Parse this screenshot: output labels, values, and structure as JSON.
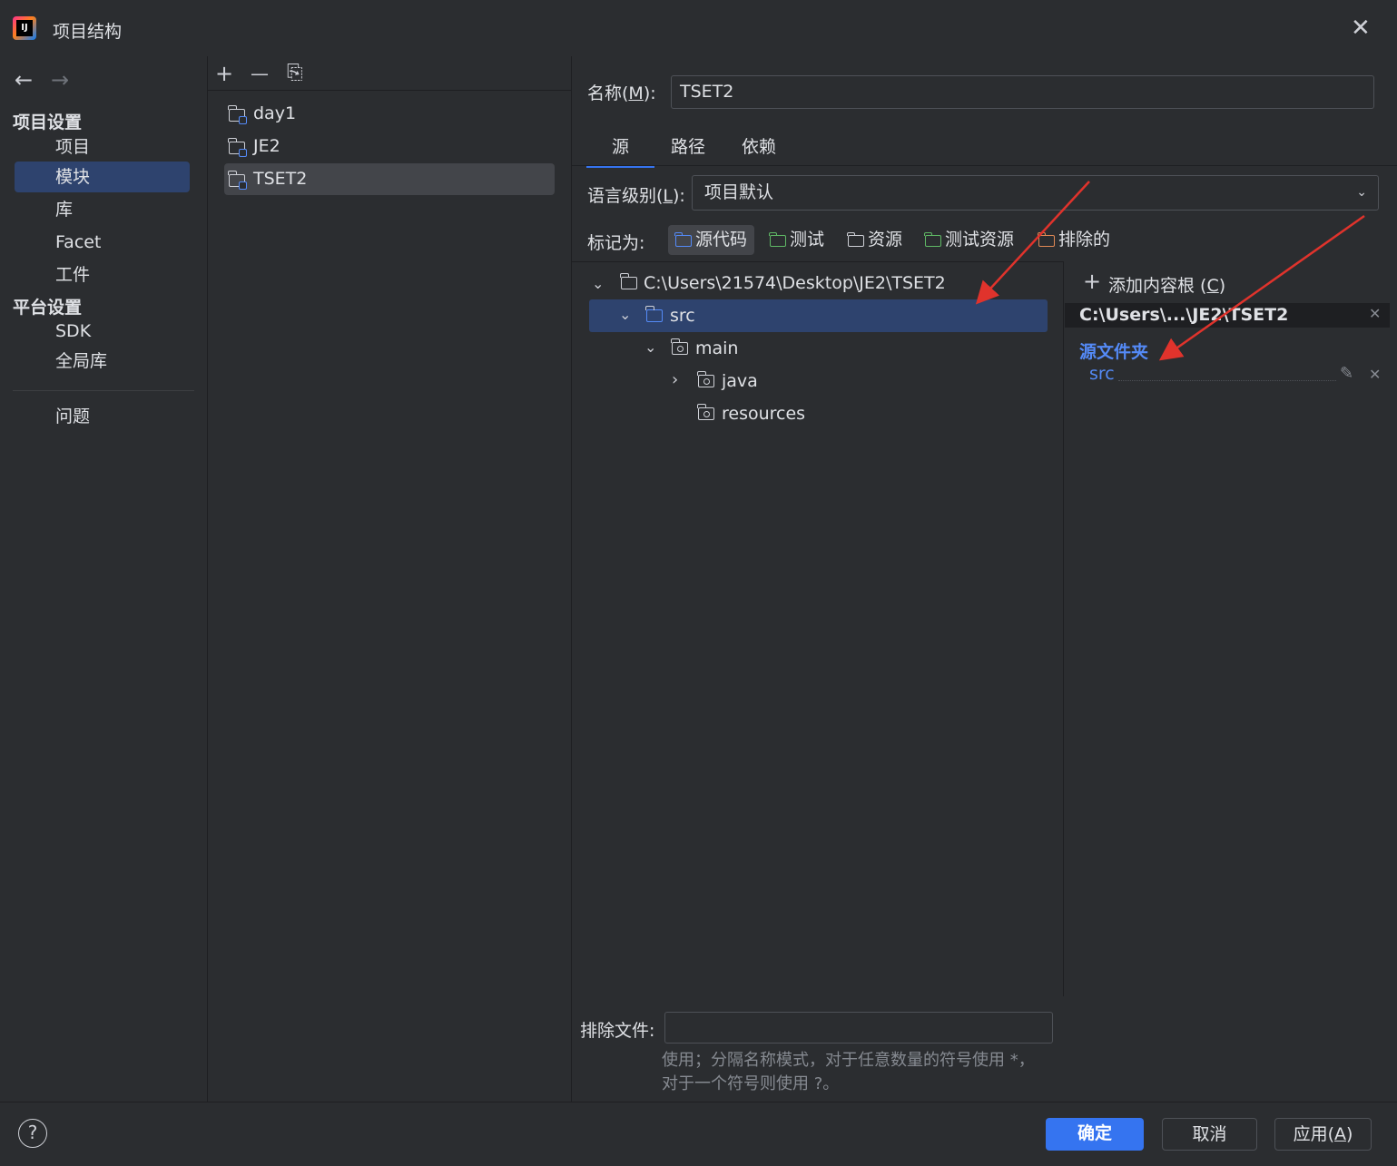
{
  "window": {
    "title": "项目结构",
    "close_glyph": "✕"
  },
  "nav": {
    "back": "←",
    "forward": "→"
  },
  "sidebar": {
    "project_settings_title": "项目设置",
    "project_items": [
      "项目",
      "模块",
      "库",
      "Facet",
      "工件"
    ],
    "platform_settings_title": "平台设置",
    "platform_items": [
      "SDK",
      "全局库"
    ],
    "problems": "问题",
    "selected": "模块"
  },
  "module_list": {
    "toolbar": {
      "add": "+",
      "remove": "—",
      "copy": "⎘"
    },
    "modules": [
      "day1",
      "JE2",
      "TSET2"
    ],
    "selected": "TSET2"
  },
  "detail": {
    "name_label": "名称(",
    "name_mnemonic": "M",
    "name_suffix": "):",
    "name_value": "TSET2",
    "tabs": [
      "源",
      "路径",
      "依赖"
    ],
    "active_tab": "源",
    "lang_label": "语言级别(",
    "lang_mnemonic": "L",
    "lang_suffix": "):",
    "lang_value": "项目默认",
    "mark_as_label": "标记为:",
    "mark_buttons": [
      {
        "label": "源代码",
        "color": "#548af7"
      },
      {
        "label": "测试",
        "color": "#5fb865"
      },
      {
        "label": "资源",
        "color": "#ced0d6"
      },
      {
        "label": "测试资源",
        "color": "#5fb865"
      },
      {
        "label": "排除的",
        "color": "#e08855"
      }
    ],
    "tree": {
      "root": "C:\\Users\\21574\\Desktop\\JE2\\TSET2",
      "src": "src",
      "main": "main",
      "java": "java",
      "resources": "resources"
    },
    "content_root": {
      "add_label": "添加内容根 (",
      "add_mnemonic": "C",
      "add_suffix": ")",
      "path": "C:\\Users\\...\\JE2\\TSET2",
      "source_folders_title": "源文件夹",
      "source_folder": "src"
    },
    "exclude_label": "排除文件:",
    "exclude_value": "",
    "exclude_hint_1": "使用；分隔名称模式，对于任意数量的符号使用 *，",
    "exclude_hint_2": "对于一个符号则使用 ?。"
  },
  "footer": {
    "help": "?",
    "ok": "确定",
    "cancel": "取消",
    "apply_prefix": "应用(",
    "apply_mnemonic": "A",
    "apply_suffix": ")"
  },
  "colors": {
    "accent": "#3574f0",
    "selection": "#2e436e",
    "annotation_arrow": "#e0332c"
  }
}
